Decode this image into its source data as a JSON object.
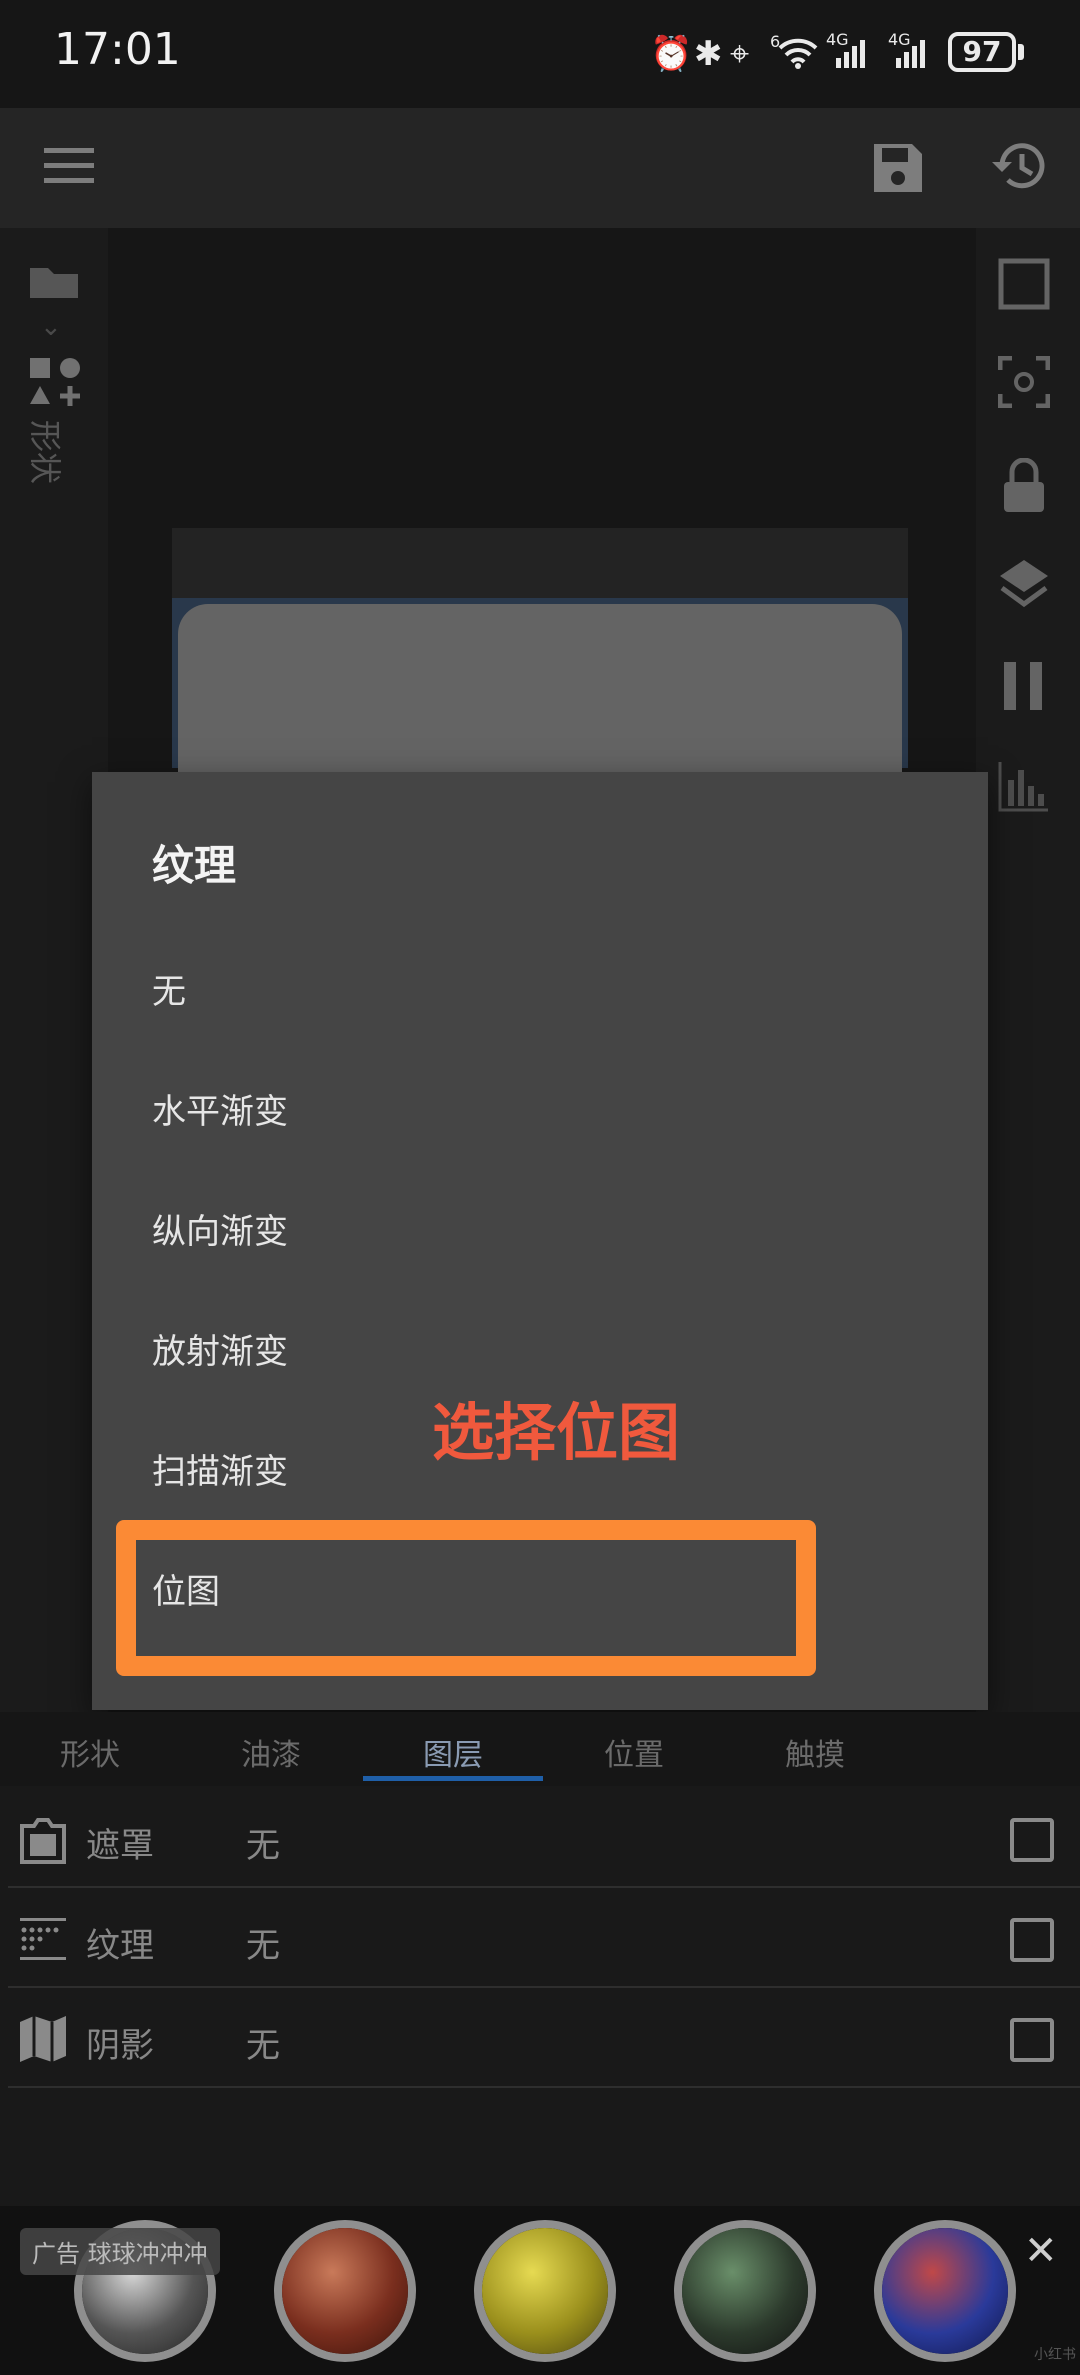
{
  "status_bar": {
    "time": "17:01",
    "battery": "97",
    "icons": [
      "alarm-icon",
      "bluetooth-icon",
      "location-icon",
      "wifi-icon",
      "signal-4g-icon",
      "signal-4g-icon"
    ],
    "network_labels": [
      "6",
      "4G",
      "4G"
    ]
  },
  "toolbar": {
    "icons": [
      "menu-icon",
      "save-icon",
      "history-icon"
    ]
  },
  "left_panel": {
    "shape_label": "形状"
  },
  "right_panel": {
    "icons": [
      "square-icon",
      "focus-icon",
      "lock-icon",
      "layers-icon",
      "pause-icon",
      "chart-icon"
    ]
  },
  "dialog": {
    "title": "纹理",
    "options": [
      "无",
      "水平渐变",
      "纵向渐变",
      "放射渐变",
      "扫描渐变",
      "位图"
    ],
    "highlighted_option": "位图"
  },
  "annotation": {
    "text": "选择位图",
    "color": "#f0593d"
  },
  "tabs": {
    "items": [
      "形状",
      "油漆",
      "图层",
      "位置",
      "触摸"
    ],
    "active": "图层"
  },
  "rows": [
    {
      "label": "遮罩",
      "value": "无",
      "icon": "mask-icon"
    },
    {
      "label": "纹理",
      "value": "无",
      "icon": "texture-icon"
    },
    {
      "label": "阴影",
      "value": "无",
      "icon": "shadow-icon"
    }
  ],
  "ad": {
    "label": "广告 球球冲冲冲",
    "close": "✕",
    "watermark": "小红书"
  },
  "colors": {
    "highlight": "#fb8a35",
    "tab_active_underline": "#1f5fa8"
  }
}
